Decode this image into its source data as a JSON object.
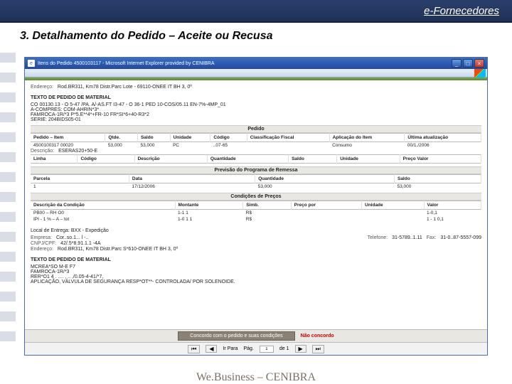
{
  "slide": {
    "header": "e-Fornecedores",
    "number": "3.",
    "title": "Detalhamento do Pedido – Aceite ou Recusa",
    "footer": "We.Business – CENIBRA"
  },
  "browser": {
    "title": "Itens do Pedido 4500103117 - Microsoft Internet Explorer provided by CENIBRA"
  },
  "endereco": {
    "label": "Endereço:",
    "value": "Rod.BR311, Km78 Distr.Parc Lote - 69110-ONEE IT BH 3, 0º"
  },
  "texto_pedido": {
    "title": "TEXTO DE PEDIDO DE MATERIAL",
    "lines": [
      "CO 00130.13 - O 5-47 /PA. A/-AS.FT I3-47 - O 36-1 PED 10-COS/05.11 EN-7%-4MP_01",
      "A-COMPRES: COM-AHRIN*3*",
      "FAMROCA-1R/*3   P*5.E**4*+FR-10   FR*SI*6+40-R3*2",
      "SERIE: 204BIDS05-01"
    ]
  },
  "pedido": {
    "band": "Pedido",
    "cols": [
      "Pedido – Item",
      "Qtde.",
      "Saldo",
      "Unidade",
      "Código",
      "Classificação Fiscal",
      "Aplicação do Item",
      "Última atualização"
    ],
    "row": [
      "4500100317  00020",
      "53,000",
      "53,000",
      "PC",
      "..07-65",
      "",
      "Consumo",
      "00/1./2006"
    ],
    "desc_label": "Descrição:",
    "desc": "ESERAS20+50-E",
    "sub_cols": [
      "Linha",
      "Código",
      "Descrição",
      "Quantidade",
      "Saldo",
      "Unidade",
      "Preço Valor"
    ]
  },
  "remessa": {
    "band": "Previsão do Programa de Remessa",
    "cols": [
      "Parcela",
      "Data",
      "Quantidade",
      "Saldo"
    ],
    "row": [
      "1",
      "17/12/2006",
      "53,000",
      "53,000"
    ]
  },
  "condicoes": {
    "band": "Condições de Preços",
    "cols": [
      "Descrição da Condição",
      "Montante",
      "Simb.",
      "Preço por",
      "Unidade",
      "Valor"
    ],
    "rows": [
      [
        "PB00 – RH O0",
        "1-1 1",
        "R$",
        "",
        "",
        "1-0,1"
      ],
      [
        "IPI - 1 % – A – tot",
        "1-0 1 1",
        "R$",
        "",
        "",
        "1 - 1 0,1"
      ]
    ]
  },
  "local": {
    "title": "Local de Entrega: BXX - Expedição",
    "rows": [
      {
        "l": "Empresa:",
        "v": "Cor..so.1... l -..",
        "tl": "Telefone:",
        "tv": "31-5789..1.11",
        "fl": "Fax:",
        "fv": "31-0..87-5557-099"
      },
      {
        "l": "CNPJ/CPF:",
        "v": "42/.5*8.91.1.1 -4A"
      },
      {
        "l": "Endereço:",
        "v": "Rod.BR311, Km78 Distr.Parc S*610-ONEE IT BH 3, 0º"
      }
    ]
  },
  "texto2": {
    "title": "TEXTO DE PEDIDO DE MATERIAL",
    "lines": [
      "MCREA*SO M-E F7",
      "FAMROCA-1R/*3",
      "RER*O1 4 . .... , .. ,/0.05-4-41/*7,",
      "APLICAÇÃO, VÁLVULA DE SEGURANÇA RESP*OT**- CONTROLADA/ POR SOLENOIDE."
    ]
  },
  "footer": {
    "accept": "Concordo com o pedido e suas condições",
    "reject": "Não concordo",
    "goto": "Ir Para",
    "page_label": "Pág.",
    "page": "1",
    "of": "de 1"
  }
}
